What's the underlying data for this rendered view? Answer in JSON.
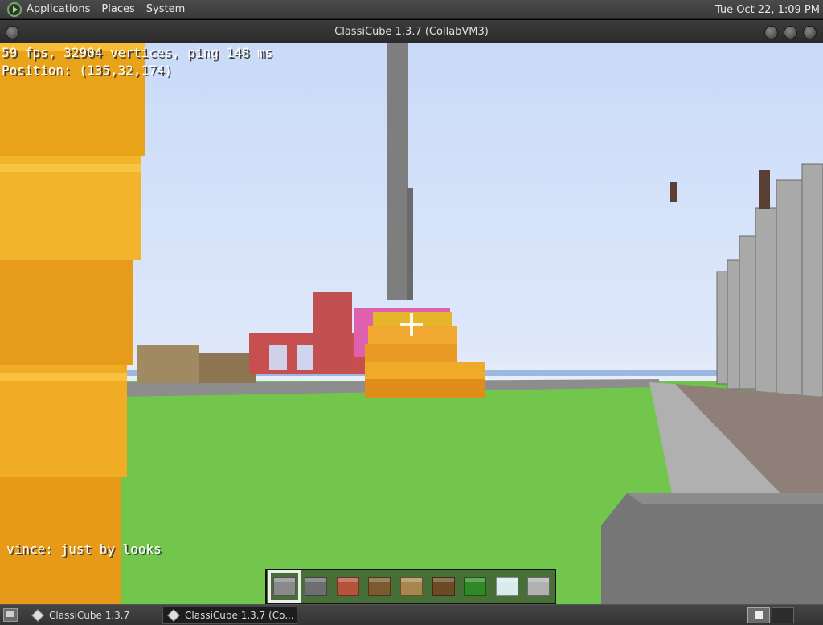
{
  "top_panel": {
    "menus": [
      "Applications",
      "Places",
      "System"
    ],
    "clock": "Tue Oct 22,  1:09 PM"
  },
  "window": {
    "title": "ClassiCube 1.3.7 (CollabVM3)"
  },
  "game": {
    "hud_line1": "59 fps, 32904 vertices, ping 148 ms",
    "hud_line2": "Position: (135,32,174)",
    "chat": "vince: just by looks",
    "hotbar": [
      {
        "name": "stone",
        "color": "#8a8a8a",
        "selected": true
      },
      {
        "name": "gravel",
        "color": "#6e6e72",
        "selected": false
      },
      {
        "name": "brick",
        "color": "#b5523b",
        "selected": false
      },
      {
        "name": "wood-log",
        "color": "#7a5a2e",
        "selected": false
      },
      {
        "name": "wood-planks",
        "color": "#a8874e",
        "selected": false
      },
      {
        "name": "tree-log",
        "color": "#6b4a24",
        "selected": false
      },
      {
        "name": "leaves",
        "color": "#2f8a26",
        "selected": false
      },
      {
        "name": "glass",
        "color": "#d8ecec",
        "selected": false
      },
      {
        "name": "slab",
        "color": "#b0b0b0",
        "selected": false
      }
    ]
  },
  "taskbar": {
    "tasks": [
      {
        "label": "ClassiCube 1.3.7",
        "active": false
      },
      {
        "label": "ClassiCube 1.3.7 (Co...",
        "active": true
      }
    ]
  }
}
